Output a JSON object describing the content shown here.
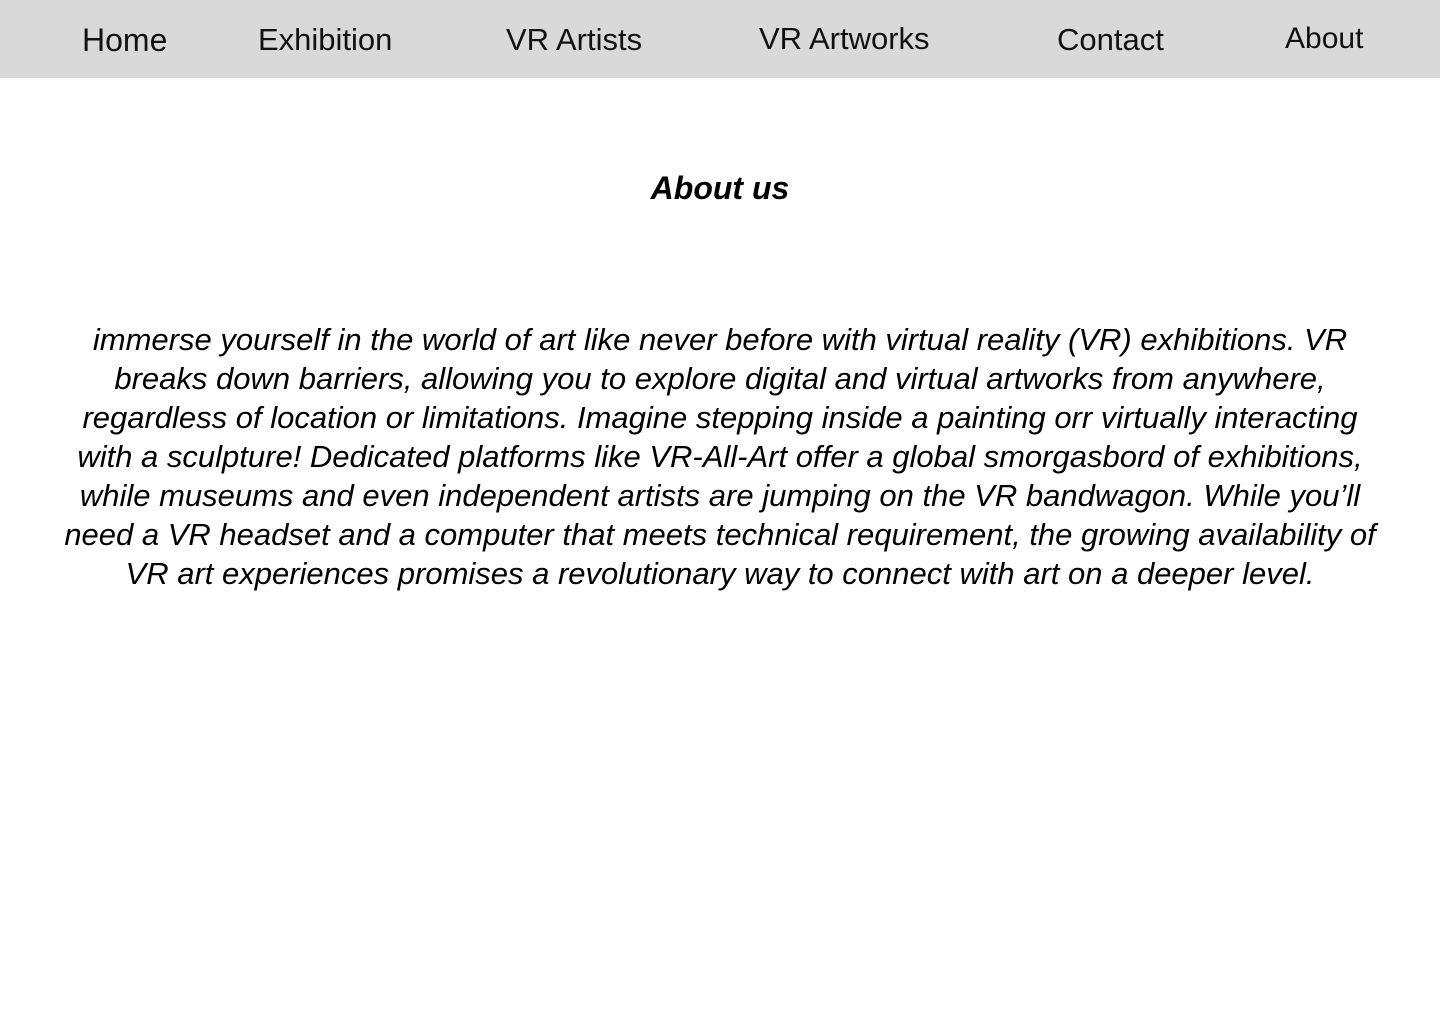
{
  "nav": {
    "home": "Home",
    "exhibition": "Exhibition",
    "vr_artists": "VR Artists",
    "vr_artworks": "VR Artworks",
    "contact": "Contact",
    "about": "About"
  },
  "colors": {
    "navbar_background": "#d9d9d9",
    "page_background": "#ffffff",
    "text": "#000000"
  },
  "main": {
    "title": "About us",
    "body": "immerse yourself in the world of art like never before with virtual reality (VR) exhibitions. VR breaks down barriers, allowing you to explore digital and virtual artworks from anywhere, regardless of location or limitations. Imagine stepping inside a painting orr virtually interacting with a sculpture! Dedicated platforms like VR-All-Art offer a global smorgasbord of exhibitions, while museums and even independent artists are jumping on the VR bandwagon. While you’ll need a VR headset and a computer that meets technical requirement, the growing availability of VR art experiences promises a revolutionary way to connect with art on a deeper level."
  }
}
